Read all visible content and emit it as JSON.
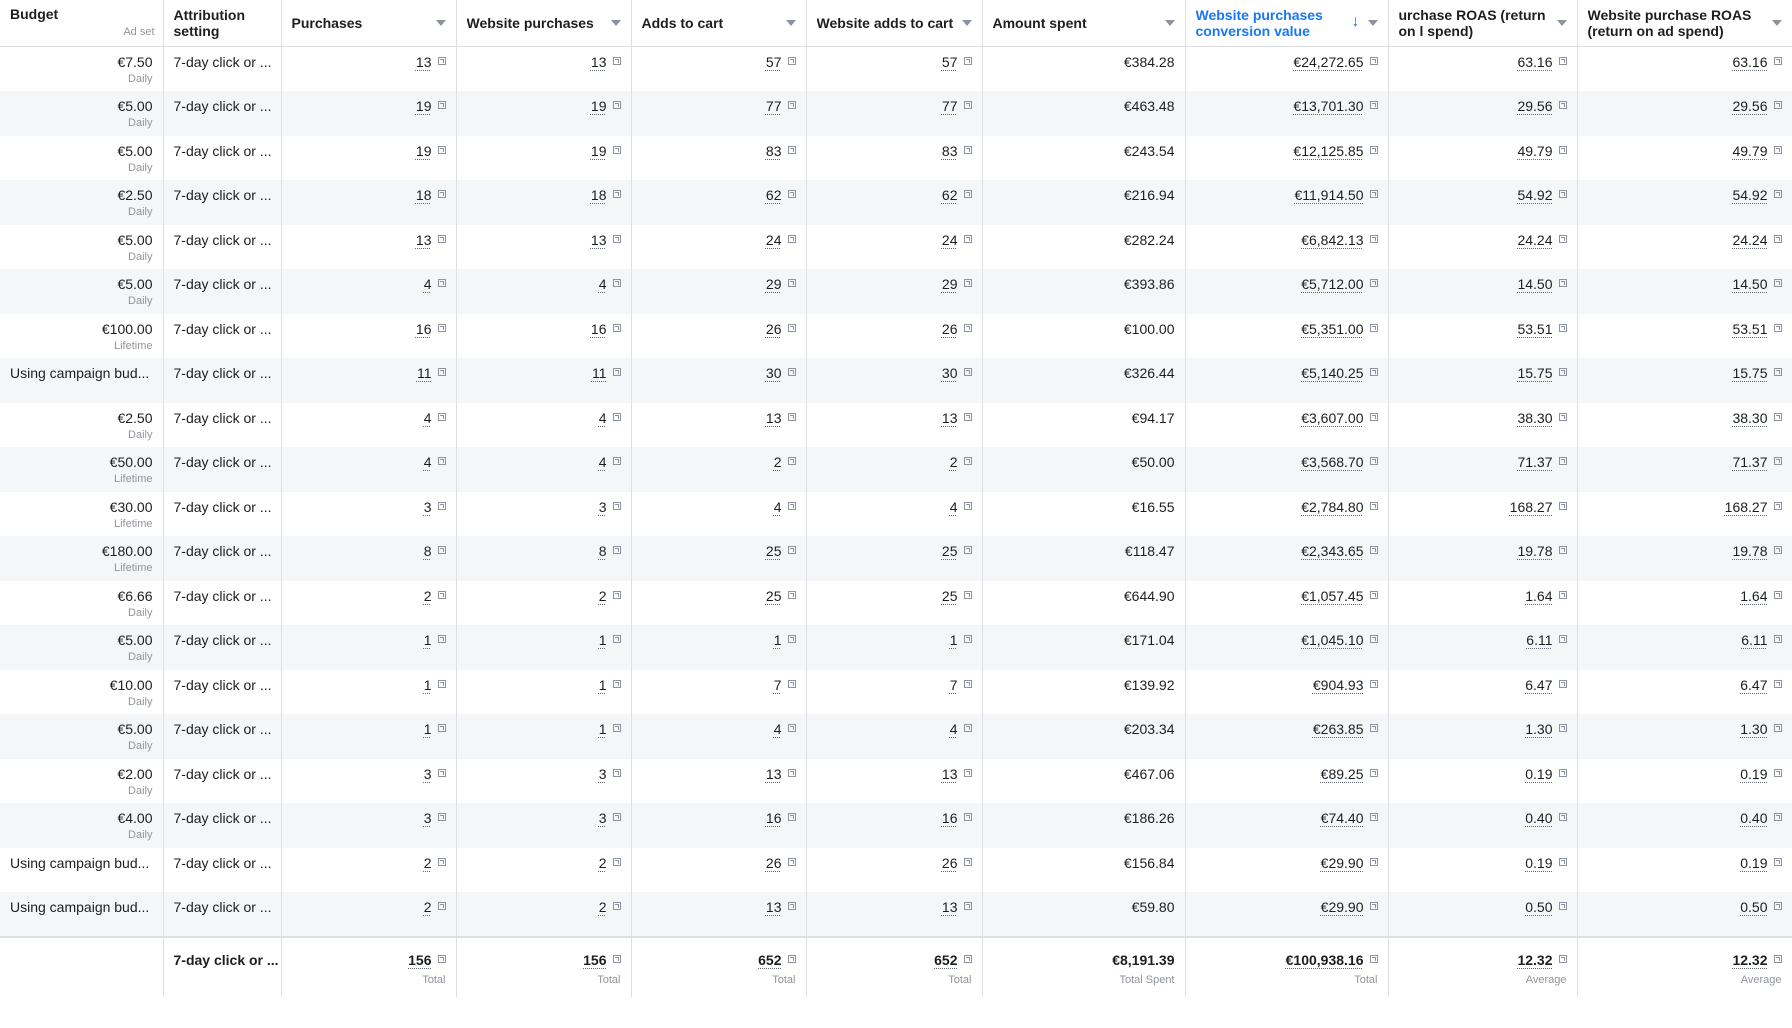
{
  "headers": [
    {
      "label": "Budget",
      "sublabel": "Ad set"
    },
    {
      "label": "Attribution setting"
    },
    {
      "label": "Purchases"
    },
    {
      "label": "Website purchases"
    },
    {
      "label": "Adds to cart"
    },
    {
      "label": "Website adds to cart"
    },
    {
      "label": "Amount spent"
    },
    {
      "label": "Website purchases conversion value",
      "sorted": "descending"
    },
    {
      "label": "urchase ROAS (return on l spend)"
    },
    {
      "label": "Website purchase ROAS (return on ad spend)"
    }
  ],
  "rows": [
    {
      "budget": "€7.50",
      "period": "Daily",
      "attr": "7-day click or ...",
      "purchases": "13",
      "web_purchases": "13",
      "atc": "57",
      "web_atc": "57",
      "spent": "€384.28",
      "conv_value": "€24,272.65",
      "roas": "63.16",
      "web_roas": "63.16"
    },
    {
      "budget": "€5.00",
      "period": "Daily",
      "attr": "7-day click or ...",
      "purchases": "19",
      "web_purchases": "19",
      "atc": "77",
      "web_atc": "77",
      "spent": "€463.48",
      "conv_value": "€13,701.30",
      "roas": "29.56",
      "web_roas": "29.56"
    },
    {
      "budget": "€5.00",
      "period": "Daily",
      "attr": "7-day click or ...",
      "purchases": "19",
      "web_purchases": "19",
      "atc": "83",
      "web_atc": "83",
      "spent": "€243.54",
      "conv_value": "€12,125.85",
      "roas": "49.79",
      "web_roas": "49.79"
    },
    {
      "budget": "€2.50",
      "period": "Daily",
      "attr": "7-day click or ...",
      "purchases": "18",
      "web_purchases": "18",
      "atc": "62",
      "web_atc": "62",
      "spent": "€216.94",
      "conv_value": "€11,914.50",
      "roas": "54.92",
      "web_roas": "54.92"
    },
    {
      "budget": "€5.00",
      "period": "Daily",
      "attr": "7-day click or ...",
      "purchases": "13",
      "web_purchases": "13",
      "atc": "24",
      "web_atc": "24",
      "spent": "€282.24",
      "conv_value": "€6,842.13",
      "roas": "24.24",
      "web_roas": "24.24"
    },
    {
      "budget": "€5.00",
      "period": "Daily",
      "attr": "7-day click or ...",
      "purchases": "4",
      "web_purchases": "4",
      "atc": "29",
      "web_atc": "29",
      "spent": "€393.86",
      "conv_value": "€5,712.00",
      "roas": "14.50",
      "web_roas": "14.50"
    },
    {
      "budget": "€100.00",
      "period": "Lifetime",
      "attr": "7-day click or ...",
      "purchases": "16",
      "web_purchases": "16",
      "atc": "26",
      "web_atc": "26",
      "spent": "€100.00",
      "conv_value": "€5,351.00",
      "roas": "53.51",
      "web_roas": "53.51"
    },
    {
      "budget": "Using campaign bud...",
      "period": "",
      "attr": "7-day click or ...",
      "purchases": "11",
      "web_purchases": "11",
      "atc": "30",
      "web_atc": "30",
      "spent": "€326.44",
      "conv_value": "€5,140.25",
      "roas": "15.75",
      "web_roas": "15.75"
    },
    {
      "budget": "€2.50",
      "period": "Daily",
      "attr": "7-day click or ...",
      "purchases": "4",
      "web_purchases": "4",
      "atc": "13",
      "web_atc": "13",
      "spent": "€94.17",
      "conv_value": "€3,607.00",
      "roas": "38.30",
      "web_roas": "38.30"
    },
    {
      "budget": "€50.00",
      "period": "Lifetime",
      "attr": "7-day click or ...",
      "purchases": "4",
      "web_purchases": "4",
      "atc": "2",
      "web_atc": "2",
      "spent": "€50.00",
      "conv_value": "€3,568.70",
      "roas": "71.37",
      "web_roas": "71.37"
    },
    {
      "budget": "€30.00",
      "period": "Lifetime",
      "attr": "7-day click or ...",
      "purchases": "3",
      "web_purchases": "3",
      "atc": "4",
      "web_atc": "4",
      "spent": "€16.55",
      "conv_value": "€2,784.80",
      "roas": "168.27",
      "web_roas": "168.27"
    },
    {
      "budget": "€180.00",
      "period": "Lifetime",
      "attr": "7-day click or ...",
      "purchases": "8",
      "web_purchases": "8",
      "atc": "25",
      "web_atc": "25",
      "spent": "€118.47",
      "conv_value": "€2,343.65",
      "roas": "19.78",
      "web_roas": "19.78"
    },
    {
      "budget": "€6.66",
      "period": "Daily",
      "attr": "7-day click or ...",
      "purchases": "2",
      "web_purchases": "2",
      "atc": "25",
      "web_atc": "25",
      "spent": "€644.90",
      "conv_value": "€1,057.45",
      "roas": "1.64",
      "web_roas": "1.64"
    },
    {
      "budget": "€5.00",
      "period": "Daily",
      "attr": "7-day click or ...",
      "purchases": "1",
      "web_purchases": "1",
      "atc": "1",
      "web_atc": "1",
      "spent": "€171.04",
      "conv_value": "€1,045.10",
      "roas": "6.11",
      "web_roas": "6.11"
    },
    {
      "budget": "€10.00",
      "period": "Daily",
      "attr": "7-day click or ...",
      "purchases": "1",
      "web_purchases": "1",
      "atc": "7",
      "web_atc": "7",
      "spent": "€139.92",
      "conv_value": "€904.93",
      "roas": "6.47",
      "web_roas": "6.47"
    },
    {
      "budget": "€5.00",
      "period": "Daily",
      "attr": "7-day click or ...",
      "purchases": "1",
      "web_purchases": "1",
      "atc": "4",
      "web_atc": "4",
      "spent": "€203.34",
      "conv_value": "€263.85",
      "roas": "1.30",
      "web_roas": "1.30"
    },
    {
      "budget": "€2.00",
      "period": "Daily",
      "attr": "7-day click or ...",
      "purchases": "3",
      "web_purchases": "3",
      "atc": "13",
      "web_atc": "13",
      "spent": "€467.06",
      "conv_value": "€89.25",
      "roas": "0.19",
      "web_roas": "0.19"
    },
    {
      "budget": "€4.00",
      "period": "Daily",
      "attr": "7-day click or ...",
      "purchases": "3",
      "web_purchases": "3",
      "atc": "16",
      "web_atc": "16",
      "spent": "€186.26",
      "conv_value": "€74.40",
      "roas": "0.40",
      "web_roas": "0.40"
    },
    {
      "budget": "Using campaign bud...",
      "period": "",
      "attr": "7-day click or ...",
      "purchases": "2",
      "web_purchases": "2",
      "atc": "26",
      "web_atc": "26",
      "spent": "€156.84",
      "conv_value": "€29.90",
      "roas": "0.19",
      "web_roas": "0.19"
    },
    {
      "budget": "Using campaign bud...",
      "period": "",
      "attr": "7-day click or ...",
      "purchases": "2",
      "web_purchases": "2",
      "atc": "13",
      "web_atc": "13",
      "spent": "€59.80",
      "conv_value": "€29.90",
      "roas": "0.50",
      "web_roas": "0.50"
    }
  ],
  "totals": {
    "attr": "7-day click or ...",
    "purchases": "156",
    "purchases_label": "Total",
    "web_purchases": "156",
    "web_purchases_label": "Total",
    "atc": "652",
    "atc_label": "Total",
    "web_atc": "652",
    "web_atc_label": "Total",
    "spent": "€8,191.39",
    "spent_label": "Total Spent",
    "conv_value": "€100,938.16",
    "conv_value_label": "Total",
    "roas": "12.32",
    "roas_label": "Average",
    "web_roas": "12.32",
    "web_roas_label": "Average"
  }
}
